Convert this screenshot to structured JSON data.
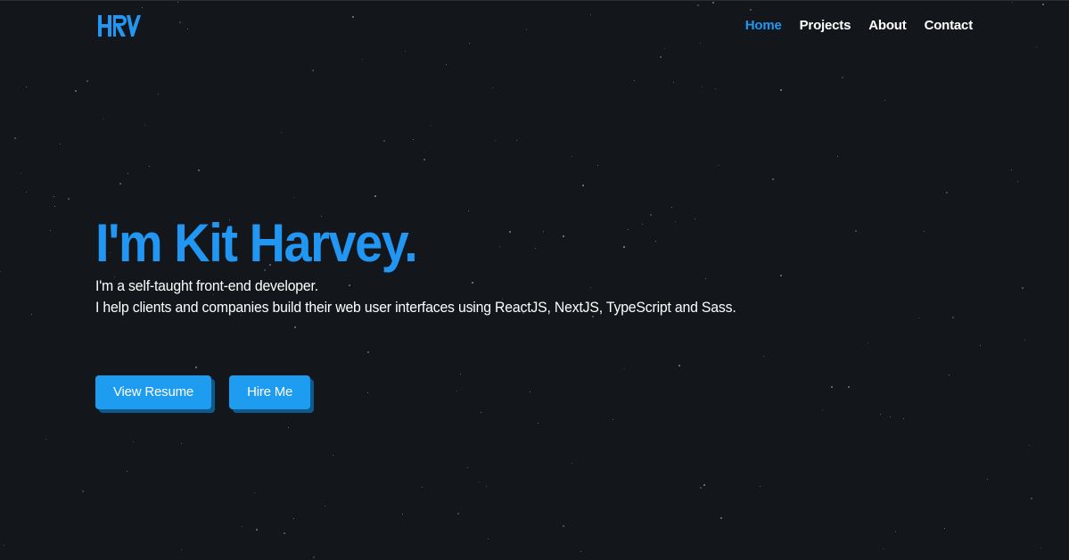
{
  "brand": {
    "logo_alt": "HRV",
    "accent_color": "#2196f3",
    "background_color": "#13161a"
  },
  "nav": {
    "items": [
      {
        "label": "Home",
        "active": true
      },
      {
        "label": "Projects",
        "active": false
      },
      {
        "label": "About",
        "active": false
      },
      {
        "label": "Contact",
        "active": false
      }
    ]
  },
  "hero": {
    "title": "I'm Kit Harvey.",
    "line1": "I'm a self-taught front-end developer.",
    "line2": "I help clients and companies build their web user interfaces using ReactJS, NextJS, TypeScript and Sass."
  },
  "actions": {
    "resume_label": "View Resume",
    "hire_label": "Hire Me"
  }
}
